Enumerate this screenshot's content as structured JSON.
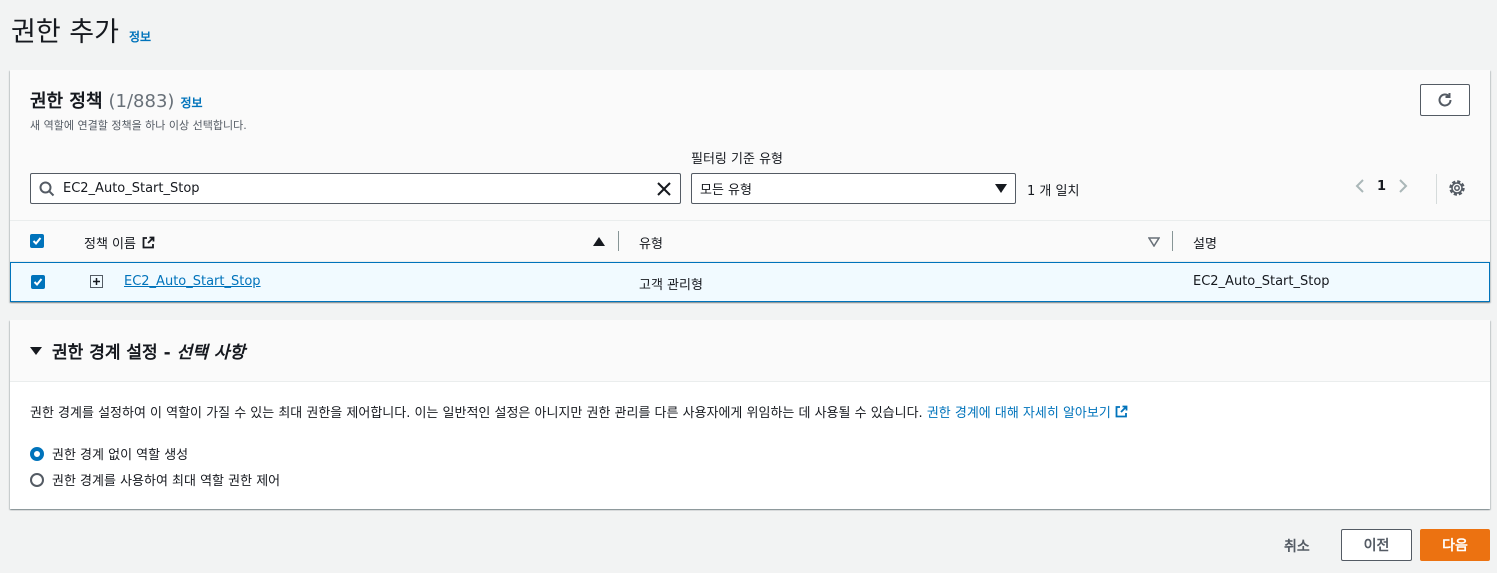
{
  "page": {
    "title": "권한 추가",
    "info": "정보"
  },
  "policies": {
    "title": "권한 정책",
    "count": "(1/883)",
    "info": "정보",
    "description": "새 역할에 연결할 정책을 하나 이상 선택합니다.",
    "search_value": "EC2_Auto_Start_Stop",
    "filter_label": "필터링 기준 유형",
    "filter_selected": "모든 유형",
    "match_count": "1 개 일치",
    "page_number": "1",
    "columns": {
      "name": "정책 이름",
      "type": "유형",
      "description": "설명"
    },
    "rows": [
      {
        "name": "EC2_Auto_Start_Stop",
        "type": "고객 관리형",
        "description": "EC2_Auto_Start_Stop",
        "selected": true
      }
    ]
  },
  "boundary": {
    "title": "권한 경계 설정 -",
    "title_optional": "선택 사항",
    "description": "권한 경계를 설정하여 이 역할이 가질 수 있는 최대 권한을 제어합니다. 이는 일반적인 설정은 아니지만 권한 관리를 다른 사용자에게 위임하는 데 사용될 수 있습니다.",
    "learn_more": "권한 경계에 대해 자세히 알아보기",
    "options": [
      {
        "label": "권한 경계 없이 역할 생성",
        "selected": true
      },
      {
        "label": "권한 경계를 사용하여 최대 역할 권한 제어",
        "selected": false
      }
    ]
  },
  "footer": {
    "cancel": "취소",
    "previous": "이전",
    "next": "다음"
  },
  "colors": {
    "primary": "#ec7211",
    "link": "#0073bb",
    "selected_row": "#f1faff"
  }
}
